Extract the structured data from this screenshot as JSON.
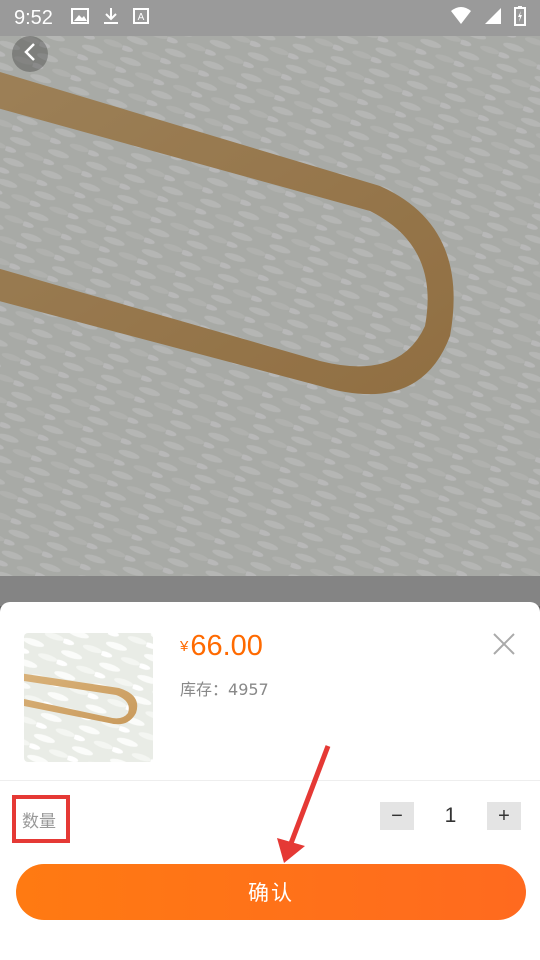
{
  "status_bar": {
    "time": "9:52",
    "icons": [
      "image-icon",
      "download-icon",
      "font-a-icon"
    ],
    "right_icons": [
      "wifi-icon",
      "signal-icon",
      "battery-charging-icon"
    ]
  },
  "product": {
    "price_symbol": "¥",
    "price": "66.00",
    "stock_label": "库存：",
    "stock_value": "4957"
  },
  "quantity": {
    "label": "数量",
    "minus": "−",
    "value": "1",
    "plus": "+"
  },
  "confirm_label": "确认",
  "colors": {
    "accent": "#ff6a00",
    "annotation": "#e53935"
  }
}
